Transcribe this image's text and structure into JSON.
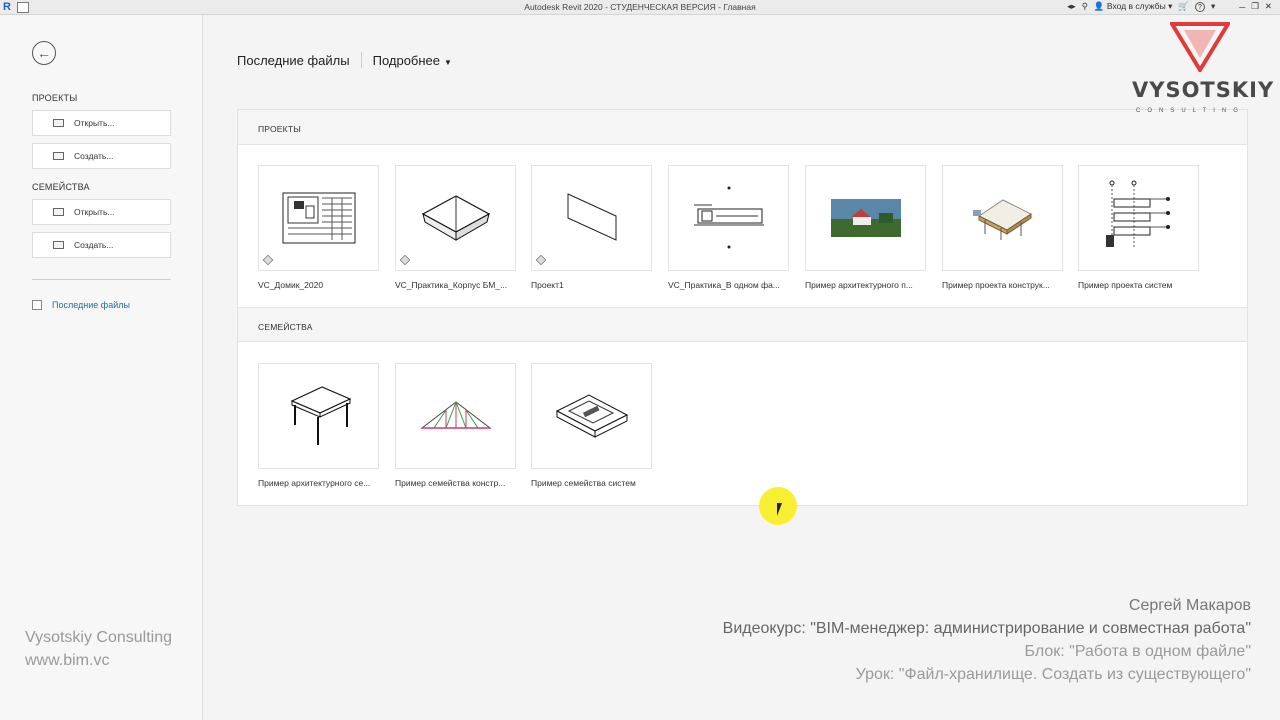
{
  "window": {
    "title": "Autodesk Revit 2020 - СТУДЕНЧЕСКАЯ ВЕРСИЯ - Главная",
    "app_logo": "R",
    "login_label": "Вход в службы",
    "help_label": "?"
  },
  "sidebar": {
    "projects_heading": "ПРОЕКТЫ",
    "projects_open": "Открыть...",
    "projects_create": "Создать...",
    "families_heading": "СЕМЕЙСТВА",
    "families_open": "Открыть...",
    "families_create": "Создать...",
    "recent_files": "Последние файлы"
  },
  "main": {
    "recent_title": "Последние файлы",
    "more_label": "Подробнее",
    "projects_section": "ПРОЕКТЫ",
    "families_section": "СЕМЕЙСТВА",
    "projects": [
      {
        "name": "VC_Домик_2020",
        "icon": "floor-plan-thumbnail"
      },
      {
        "name": "VC_Практика_Корпус БМ_...",
        "icon": "roof-model-thumbnail"
      },
      {
        "name": "Проект1",
        "icon": "plane-thumbnail"
      },
      {
        "name": "VC_Практика_В одном фа...",
        "icon": "elevation-thumbnail"
      },
      {
        "name": "Пример архитектурного п...",
        "icon": "render-thumbnail"
      },
      {
        "name": "Пример проекта конструк...",
        "icon": "structure-thumbnail"
      },
      {
        "name": "Пример проекта систем",
        "icon": "systems-thumbnail"
      }
    ],
    "families": [
      {
        "name": "Пример архитектурного се...",
        "icon": "table-thumbnail"
      },
      {
        "name": "Пример семейства констр...",
        "icon": "truss-thumbnail"
      },
      {
        "name": "Пример семейства систем",
        "icon": "tray-thumbnail"
      }
    ]
  },
  "branding": {
    "logo_text": "VYSOTSKIY",
    "logo_sub": "CONSULTING",
    "left_line1": "Vysotskiy Consulting",
    "left_line2": "www.bim.vc"
  },
  "credits": {
    "author": "Сергей Макаров",
    "course": "Видеокурс: \"BIM-менеджер: администрирование и совместная работа\"",
    "block": "Блок: \"Работа в одном файле\"",
    "lesson": "Урок: \"Файл-хранилище. Создать из существующего\""
  },
  "colors": {
    "accent_link": "#1d6fa5",
    "logo_red": "#e03a3a",
    "cursor_highlight": "#f8ee28"
  }
}
